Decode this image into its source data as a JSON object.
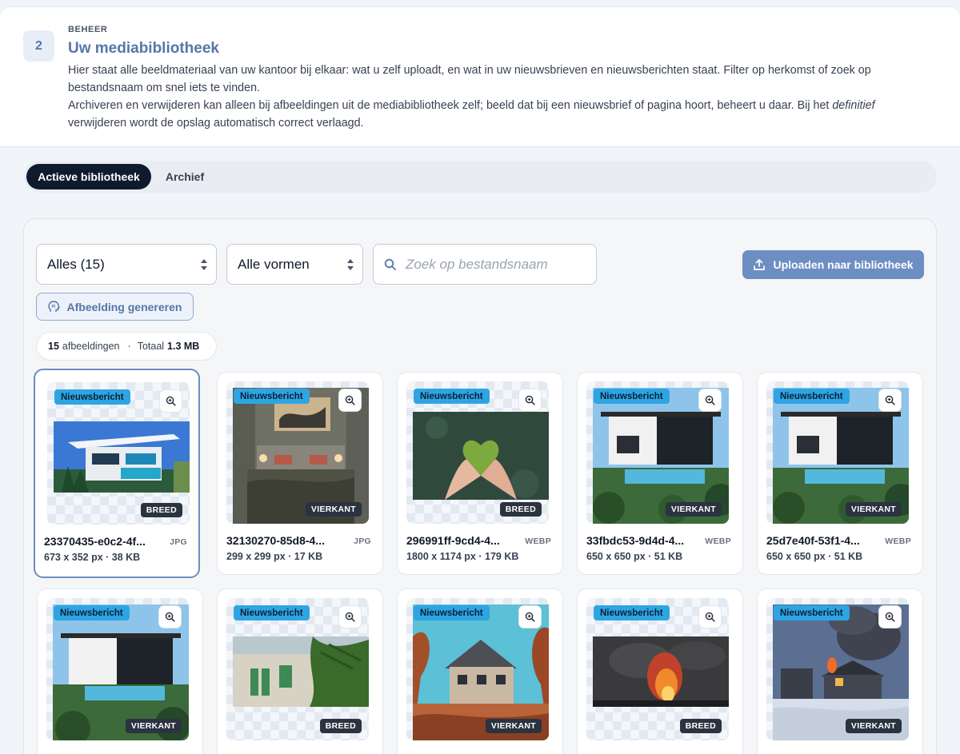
{
  "header": {
    "step": "2",
    "eyebrow": "BEHEER",
    "title": "Uw mediabibliotheek",
    "desc1": "Hier staat alle beeldmateriaal van uw kantoor bij elkaar: wat u zelf uploadt, en wat in uw nieuwsbrieven en nieuwsberichten staat. Filter op herkomst of zoek op bestandsnaam om snel iets te vinden.",
    "desc2_before": "Archiveren en verwijderen kan alleen bij afbeeldingen uit de mediabibliotheek zelf; beeld dat bij een nieuwsbrief of pagina hoort, beheert u daar. Bij het ",
    "desc2_em": "definitief",
    "desc2_after": " verwijderen wordt de opslag automatisch correct verlaagd."
  },
  "tabs": {
    "active": "Actieve bibliotheek",
    "archive": "Archief"
  },
  "filters": {
    "origin": "Alles (15)",
    "shape": "Alle vormen",
    "search_placeholder": "Zoek op bestandsnaam",
    "upload": "Uploaden naar bibliotheek",
    "generate": "Afbeelding genereren"
  },
  "summary": {
    "count": "15",
    "count_label": "afbeeldingen",
    "separator": "·",
    "total_label": "Totaal",
    "total": "1.3 MB"
  },
  "items": [
    {
      "source": "Nieuwsbericht",
      "shape": "BREED",
      "name": "23370435-e0c2-4f...",
      "type": "JPG",
      "meta": "673 x 352 px · 38 KB"
    },
    {
      "source": "Nieuwsbericht",
      "shape": "VIERKANT",
      "name": "32130270-85d8-4...",
      "type": "JPG",
      "meta": "299 x 299 px · 17 KB"
    },
    {
      "source": "Nieuwsbericht",
      "shape": "BREED",
      "name": "296991ff-9cd4-4...",
      "type": "WEBP",
      "meta": "1800 x 1174 px · 179 KB"
    },
    {
      "source": "Nieuwsbericht",
      "shape": "VIERKANT",
      "name": "33fbdc53-9d4d-4...",
      "type": "WEBP",
      "meta": "650 x 650 px · 51 KB"
    },
    {
      "source": "Nieuwsbericht",
      "shape": "VIERKANT",
      "name": "25d7e40f-53f1-4...",
      "type": "WEBP",
      "meta": "650 x 650 px · 51 KB"
    },
    {
      "source": "Nieuwsbericht",
      "shape": "VIERKANT"
    },
    {
      "source": "Nieuwsbericht",
      "shape": "BREED"
    },
    {
      "source": "Nieuwsbericht",
      "shape": "VIERKANT"
    },
    {
      "source": "Nieuwsbericht",
      "shape": "BREED"
    },
    {
      "source": "Nieuwsbericht",
      "shape": "VIERKANT"
    }
  ]
}
